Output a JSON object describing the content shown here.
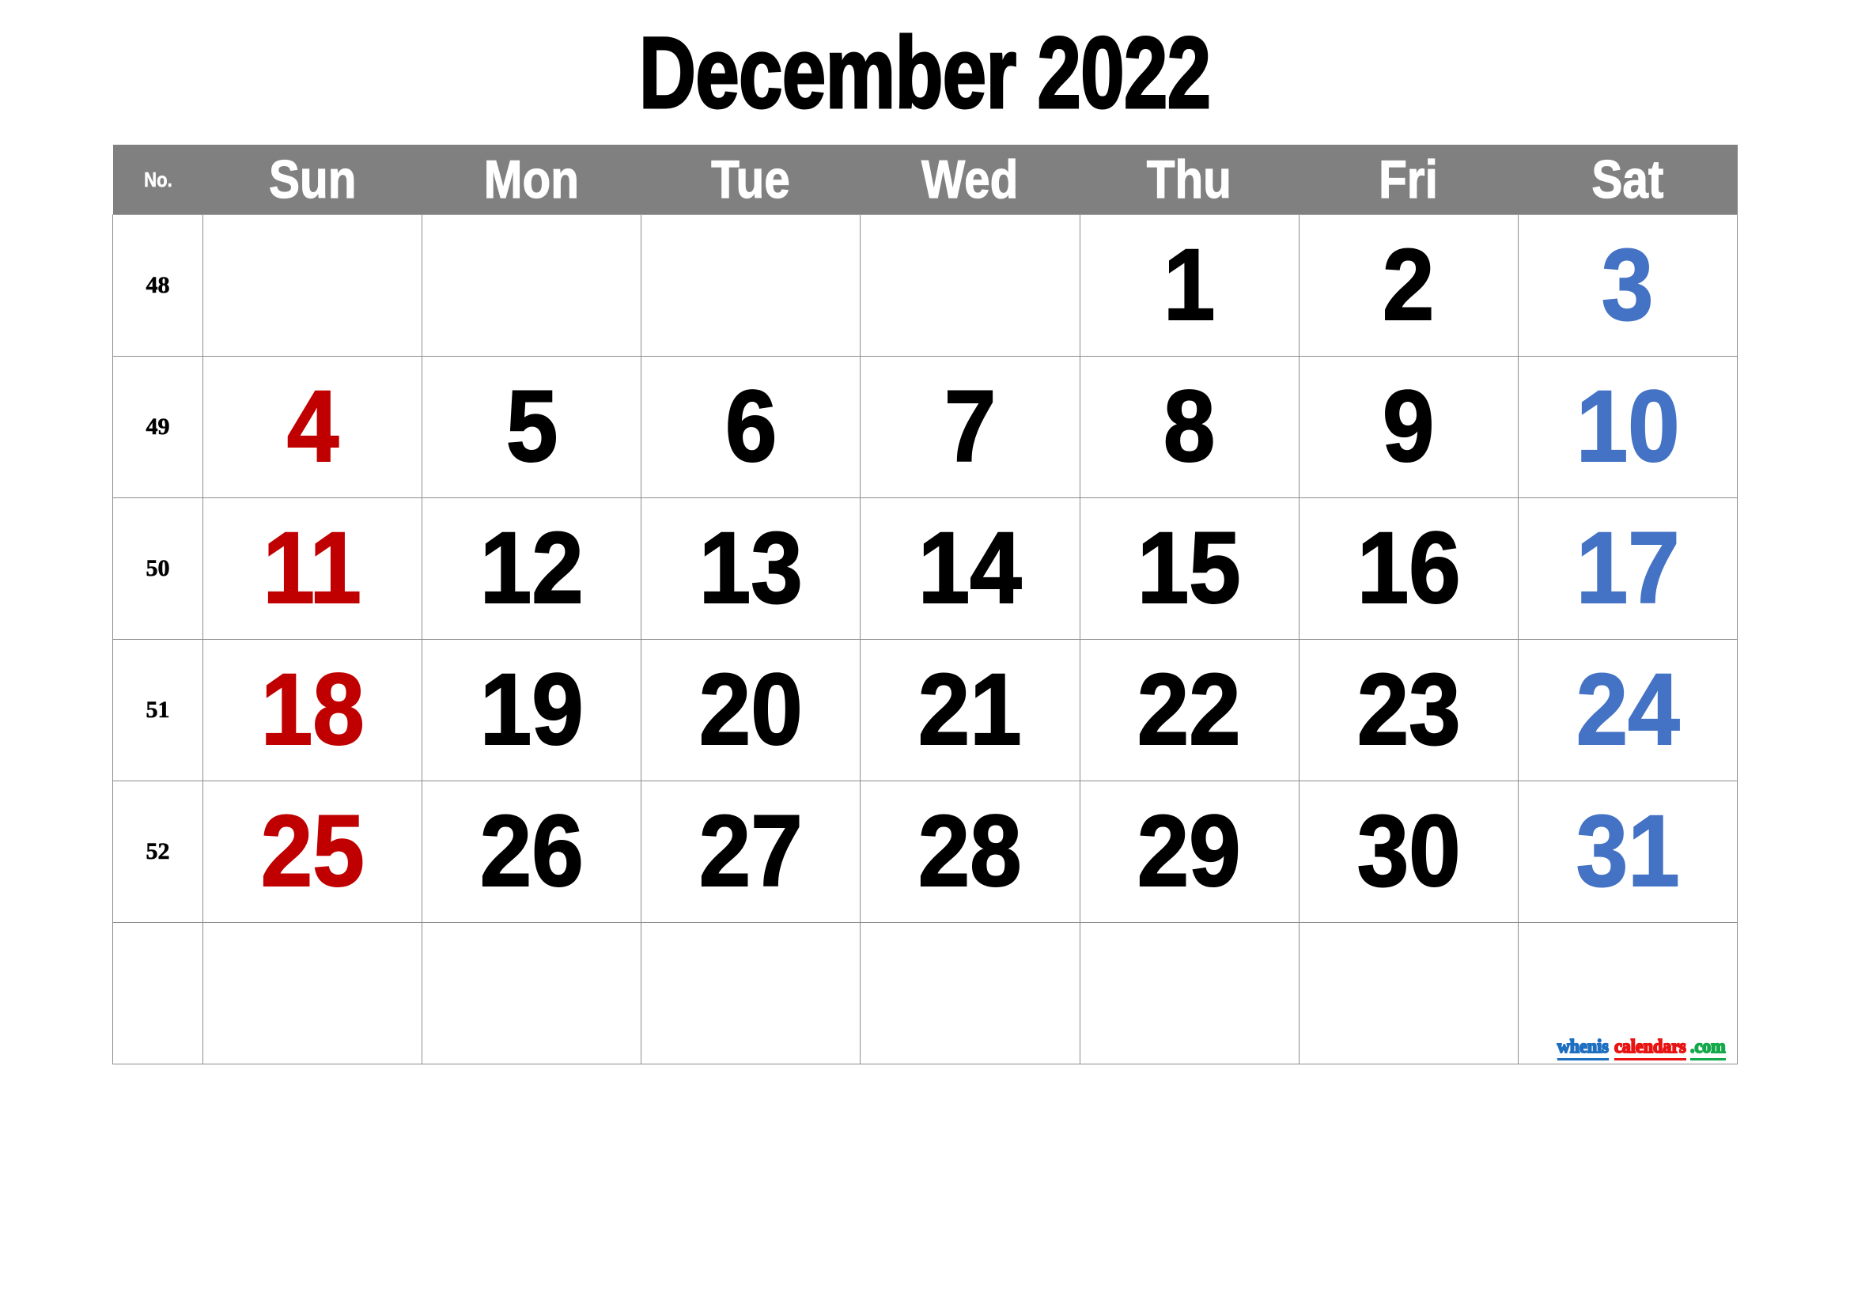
{
  "title": "December 2022",
  "header": {
    "week_label": "No.",
    "days": [
      "Sun",
      "Mon",
      "Tue",
      "Wed",
      "Thu",
      "Fri",
      "Sat"
    ]
  },
  "colors": {
    "header_bg": "#808080",
    "sunday": "#c00000",
    "weekday": "#000000",
    "saturday": "#4472c4",
    "grid": "#8c8c8c"
  },
  "weeks": [
    {
      "no": "48",
      "days": [
        "",
        "",
        "",
        "",
        "1",
        "2",
        "3"
      ]
    },
    {
      "no": "49",
      "days": [
        "4",
        "5",
        "6",
        "7",
        "8",
        "9",
        "10"
      ]
    },
    {
      "no": "50",
      "days": [
        "11",
        "12",
        "13",
        "14",
        "15",
        "16",
        "17"
      ]
    },
    {
      "no": "51",
      "days": [
        "18",
        "19",
        "20",
        "21",
        "22",
        "23",
        "24"
      ]
    },
    {
      "no": "52",
      "days": [
        "25",
        "26",
        "27",
        "28",
        "29",
        "30",
        "31"
      ]
    },
    {
      "no": "",
      "days": [
        "",
        "",
        "",
        "",
        "",
        "",
        ""
      ]
    }
  ],
  "credit": {
    "part1": "whenis",
    "part2": "calendars",
    "part3": ".com"
  }
}
